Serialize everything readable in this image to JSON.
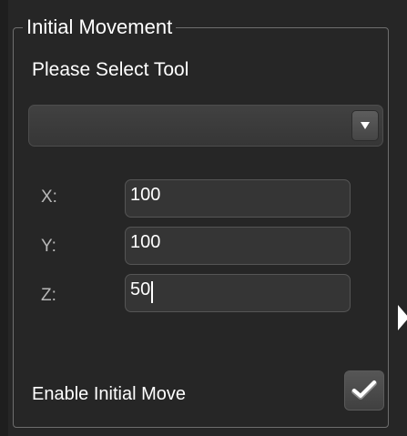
{
  "group": {
    "title": "Initial Movement"
  },
  "tool": {
    "label": "Please Select Tool",
    "selected": ""
  },
  "coords": {
    "x_label": "X:",
    "x_value": "100",
    "y_label": "Y:",
    "y_value": "100",
    "z_label": "Z:",
    "z_value": "50"
  },
  "enable": {
    "label": "Enable Initial Move",
    "checked": true
  },
  "icons": {
    "dropdown": "chevron-down-icon",
    "check": "checkmark-icon",
    "side": "caret-right-icon"
  }
}
